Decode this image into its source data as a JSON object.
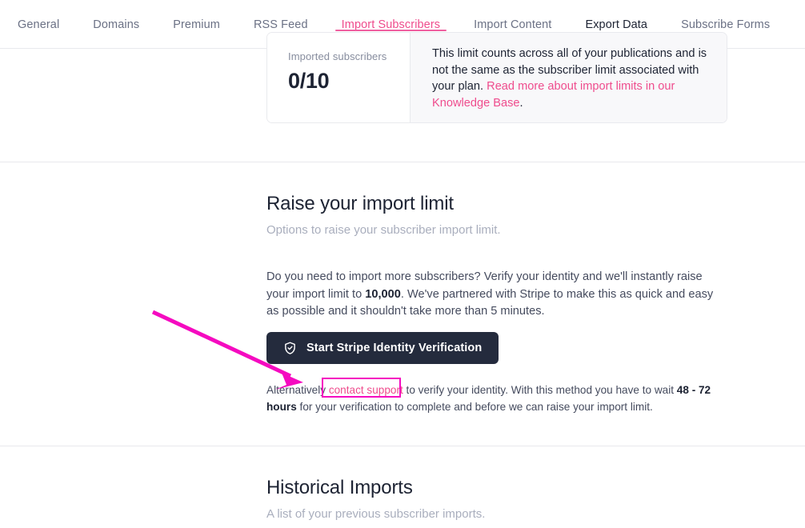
{
  "nav": {
    "tabs": [
      {
        "label": "General",
        "state": "normal"
      },
      {
        "label": "Domains",
        "state": "normal"
      },
      {
        "label": "Premium",
        "state": "normal"
      },
      {
        "label": "RSS Feed",
        "state": "normal"
      },
      {
        "label": "Import Subscribers",
        "state": "active"
      },
      {
        "label": "Import Content",
        "state": "normal"
      },
      {
        "label": "Export Data",
        "state": "dark"
      },
      {
        "label": "Subscribe Forms",
        "state": "normal"
      }
    ]
  },
  "limit_card": {
    "label": "Imported subscribers",
    "value": "0/10",
    "description_part1": "This limit counts across all of your publications and is not the same as the subscriber limit associated with your plan. ",
    "link_text": "Read more about import limits in our Knowledge Base",
    "description_part2": "."
  },
  "raise_section": {
    "title": "Raise your import limit",
    "subtitle": "Options to raise your subscriber import limit.",
    "paragraph_part1": "Do you need to import more subscribers? Verify your identity and we'll instantly raise your import limit to ",
    "paragraph_bold": "10,000",
    "paragraph_part2": ". We've partnered with Stripe to make this as quick and easy as possible and it shouldn't take more than 5 minutes.",
    "button_label": "Start Stripe Identity Verification",
    "button_icon": "shield-check-icon",
    "alt_part1": "Alternatively ",
    "alt_link": "contact support",
    "alt_part2": " to verify your identity. With this method you have to wait ",
    "alt_bold": "48 - 72 hours",
    "alt_part3": " for your verification to complete and before we can raise your import limit."
  },
  "historical_section": {
    "title": "Historical Imports",
    "subtitle": "A list of your previous subscriber imports."
  },
  "colors": {
    "accent_pink": "#ef4c8d",
    "button_dark": "#242b3d",
    "annotation_magenta": "#f50ac0",
    "text_primary": "#1d2333",
    "text_muted": "#a9aebd"
  }
}
